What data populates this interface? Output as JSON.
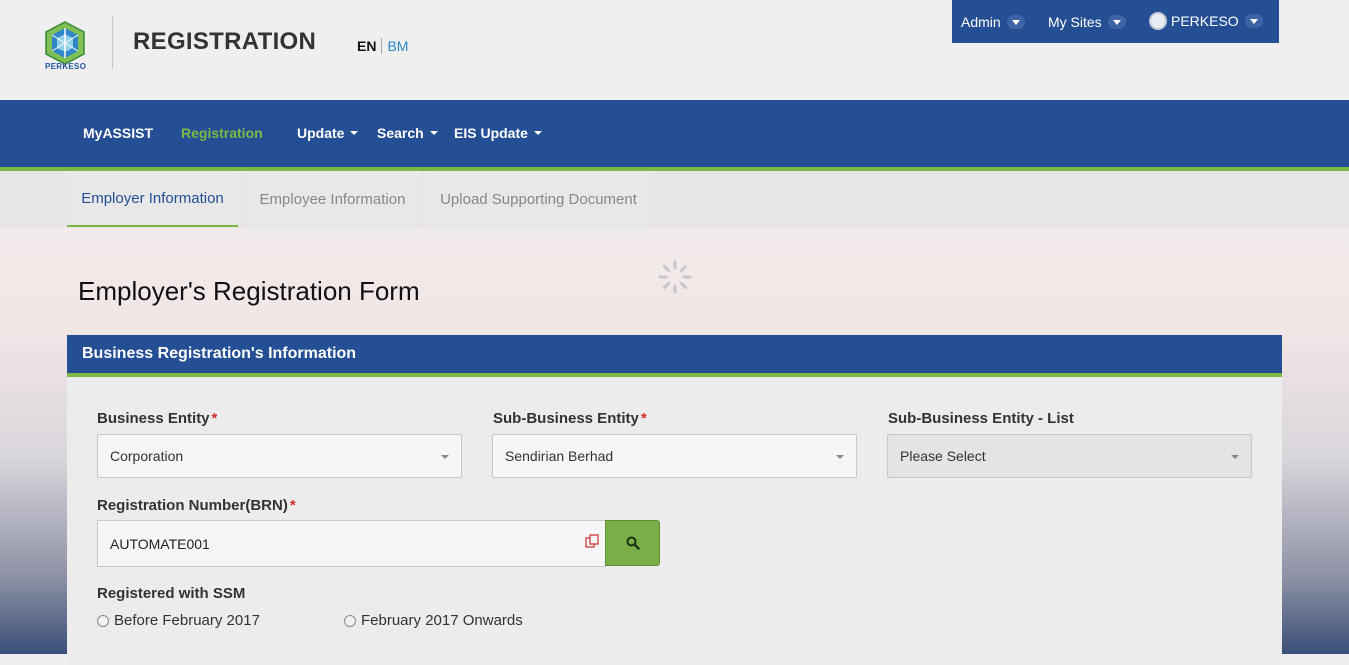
{
  "header": {
    "logo_text": "PERKESO",
    "app_title": "REGISTRATION",
    "lang_en": "EN",
    "lang_bm": "BM"
  },
  "userbar": {
    "admin": "Admin",
    "my_sites": "My Sites",
    "user": "PERKESO"
  },
  "nav": {
    "myassist": "MyASSIST",
    "registration": "Registration",
    "update": "Update",
    "search": "Search",
    "eis_update": "EIS Update"
  },
  "tabs": {
    "employer": "Employer Information",
    "employee": "Employee Information",
    "upload": "Upload Supporting Document"
  },
  "form": {
    "title": "Employer's Registration Form",
    "section_title": "Business Registration's Information",
    "business_entity_label": "Business Entity",
    "business_entity_value": "Corporation",
    "sub_business_entity_label": "Sub-Business Entity",
    "sub_business_entity_value": "Sendirian Berhad",
    "sub_business_list_label": "Sub-Business Entity - List",
    "sub_business_list_value": "Please Select",
    "brn_label": "Registration Number(BRN)",
    "brn_value": "AUTOMATE001",
    "ssm_label": "Registered with SSM",
    "radio_before": "Before February 2017",
    "radio_onwards": "February 2017 Onwards",
    "required_mark": "*"
  },
  "colors": {
    "primary": "#244f95",
    "accent_green": "#7db844",
    "required_red": "#d32a2a"
  }
}
